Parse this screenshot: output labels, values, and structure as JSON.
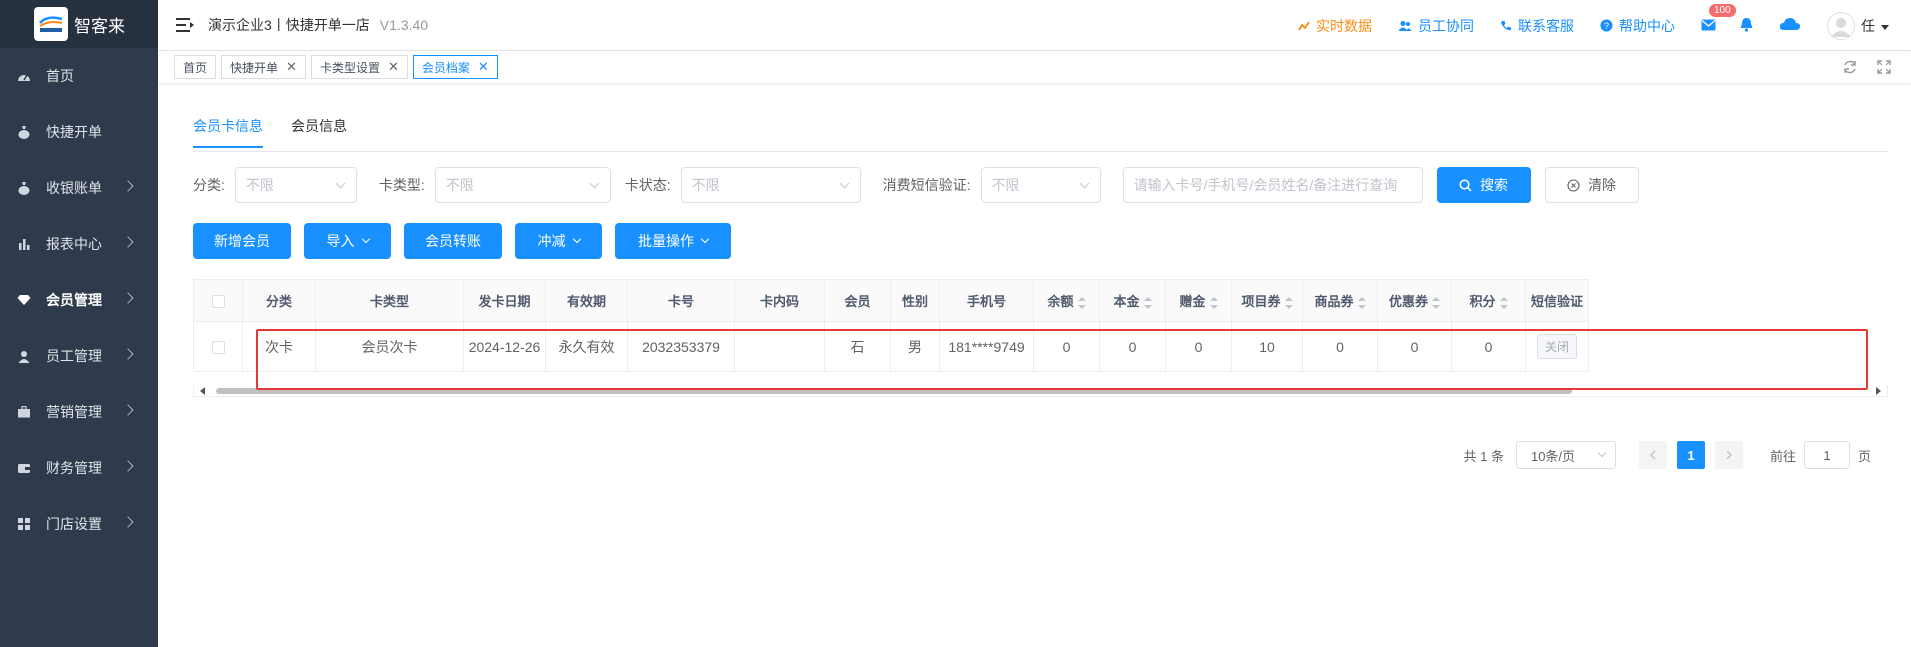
{
  "app": {
    "name": "智客来",
    "logo_text": "智客来"
  },
  "sidebar": {
    "items": [
      {
        "label": "首页",
        "icon": "dashboard-icon",
        "has_arrow": false
      },
      {
        "label": "快捷开单",
        "icon": "bag-icon",
        "has_arrow": false
      },
      {
        "label": "收银账单",
        "icon": "bag-icon",
        "has_arrow": true
      },
      {
        "label": "报表中心",
        "icon": "bar-chart-icon",
        "has_arrow": true
      },
      {
        "label": "会员管理",
        "icon": "diamond-icon",
        "has_arrow": true
      },
      {
        "label": "员工管理",
        "icon": "user-icon",
        "has_arrow": true
      },
      {
        "label": "营销管理",
        "icon": "briefcase-icon",
        "has_arrow": true
      },
      {
        "label": "财务管理",
        "icon": "wallet-icon",
        "has_arrow": true
      },
      {
        "label": "门店设置",
        "icon": "grid-icon",
        "has_arrow": true
      }
    ]
  },
  "header": {
    "company": "演示企业3丨快捷开单一店",
    "version": "V1.3.40",
    "links": {
      "realtime": "实时数据",
      "staff": "员工协同",
      "contact": "联系客服",
      "help": "帮助中心"
    },
    "mail_badge": "100",
    "user": "任"
  },
  "tags": [
    {
      "label": "首页",
      "closable": false
    },
    {
      "label": "快捷开单",
      "closable": true
    },
    {
      "label": "卡类型设置",
      "closable": true
    },
    {
      "label": "会员档案",
      "closable": true
    }
  ],
  "sub_tabs": {
    "card_info": "会员卡信息",
    "member_info": "会员信息"
  },
  "filters": {
    "category_label": "分类:",
    "category_value": "不限",
    "card_type_label": "卡类型:",
    "card_type_value": "不限",
    "card_status_label": "卡状态:",
    "card_status_value": "不限",
    "sms_label": "消费短信验证:",
    "sms_value": "不限",
    "search_placeholder": "请输入卡号/手机号/会员姓名/备注进行查询",
    "search_button": "搜索",
    "clear_button": "清除"
  },
  "actions": {
    "add_member": "新增会员",
    "import": "导入",
    "transfer": "会员转账",
    "offset": "冲减",
    "batch": "批量操作"
  },
  "table": {
    "headers": [
      "分类",
      "卡类型",
      "发卡日期",
      "有效期",
      "卡号",
      "卡内码",
      "会员",
      "性别",
      "手机号",
      "余额",
      "本金",
      "赠金",
      "项目券",
      "商品券",
      "优惠券",
      "积分",
      "短信验证"
    ],
    "rows": [
      [
        "次卡",
        "会员次卡",
        "2024-12-26",
        "永久有效",
        "2032353379",
        "",
        "石",
        "男",
        "181****9749",
        "0",
        "0",
        "0",
        "10",
        "0",
        "0",
        "0",
        "关闭"
      ]
    ]
  },
  "pagination": {
    "total": "共 1 条",
    "page_size": "10条/页",
    "current": "1",
    "goto_prefix": "前往",
    "goto_value": "1",
    "goto_suffix": "页"
  },
  "colors": {
    "primary": "#1890ff",
    "sidebar": "#2f3b4c",
    "highlight": "#e53935"
  }
}
